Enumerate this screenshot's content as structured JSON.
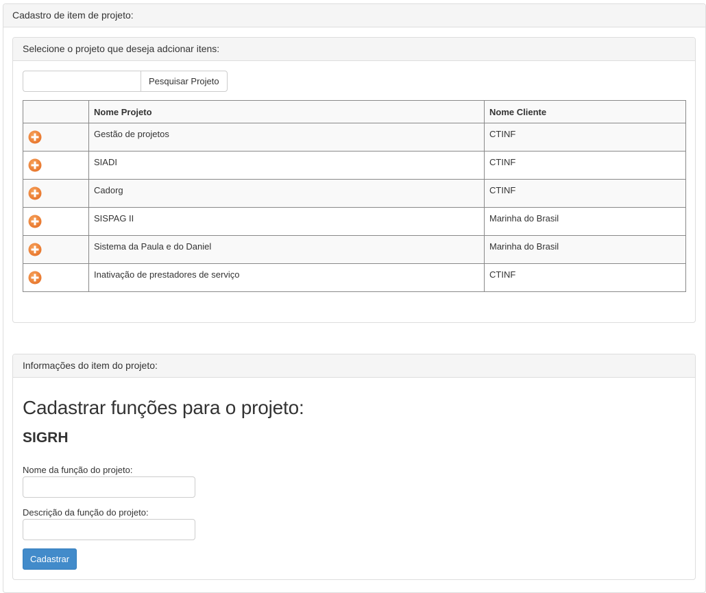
{
  "outer_panel": {
    "title": "Cadastro de item de projeto:"
  },
  "select_panel": {
    "title": "Selecione o projeto que deseja adcionar itens:",
    "search": {
      "value": "",
      "placeholder": "",
      "button_label": "Pesquisar Projeto"
    },
    "table": {
      "columns": [
        "",
        "Nome Projeto",
        "Nome Cliente"
      ],
      "rows": [
        {
          "name": "Gestão de projetos",
          "client": "CTINF"
        },
        {
          "name": "SIADI",
          "client": "CTINF"
        },
        {
          "name": "Cadorg",
          "client": "CTINF"
        },
        {
          "name": "SISPAG II",
          "client": "Marinha do Brasil"
        },
        {
          "name": "Sistema da Paula e do Daniel",
          "client": "Marinha do Brasil"
        },
        {
          "name": "Inativação de prestadores de serviço",
          "client": "CTINF"
        }
      ],
      "row_icon": "add-circle-icon",
      "icon_color": "#e8772e"
    }
  },
  "info_panel": {
    "title": "Informações do item do projeto:",
    "heading": "Cadastrar funções para o projeto:",
    "project_name": "SIGRH",
    "fields": [
      {
        "label": "Nome da função do projeto:",
        "value": ""
      },
      {
        "label": "Descrição da função do projeto:",
        "value": ""
      }
    ],
    "submit_label": "Cadastrar",
    "submit_color": "#428bca"
  }
}
